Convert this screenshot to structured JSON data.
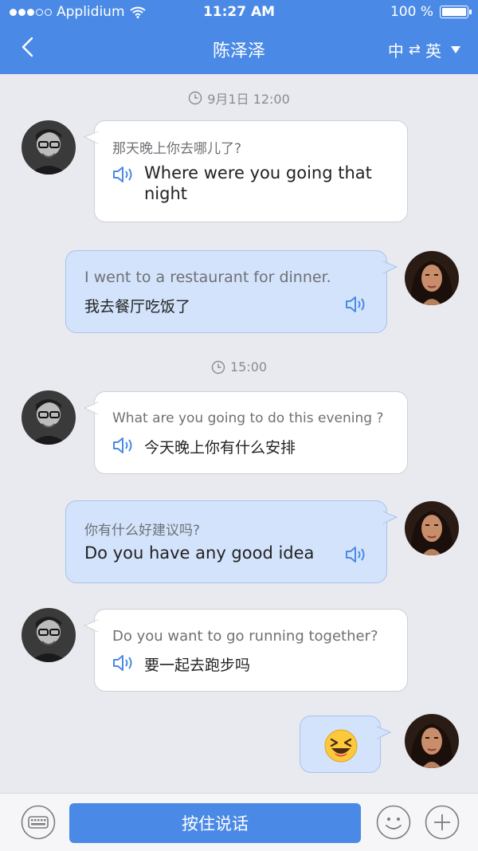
{
  "status_bar": {
    "carrier": "Applidium",
    "time": "11:27 AM",
    "battery": "100 %"
  },
  "nav": {
    "title": "陈泽泽",
    "lang_from": "中",
    "lang_swap": "⇄",
    "lang_to": "英"
  },
  "icons": {
    "back": "chevron-left-icon",
    "speaker": "speaker-icon",
    "clock": "clock-icon",
    "keyboard": "keyboard-icon",
    "emoji": "smiley-icon",
    "plus": "plus-icon"
  },
  "colors": {
    "header": "#4a8ae6",
    "background": "#e9eaef",
    "bubble_right": "#d2e3fb",
    "accent": "#4a8ae6"
  },
  "messages": {
    "ts1": "9月1日 12:00",
    "m1": {
      "original": "那天晚上你去哪儿了?",
      "translation": "Where were you going that night"
    },
    "m2": {
      "original": "I went to a restaurant for dinner.",
      "translation": "我去餐厅吃饭了"
    },
    "ts2": "15:00",
    "m3": {
      "original": "What are you going to do this evening ?",
      "translation": "今天晚上你有什么安排"
    },
    "m4": {
      "original": "你有什么好建议吗?",
      "translation": "Do you have any good idea"
    },
    "m5": {
      "original": "Do you want to go running together?",
      "translation": "要一起去跑步吗"
    },
    "m6": {
      "emoji": "😆"
    }
  },
  "bottom": {
    "talk_label": "按住说话"
  }
}
